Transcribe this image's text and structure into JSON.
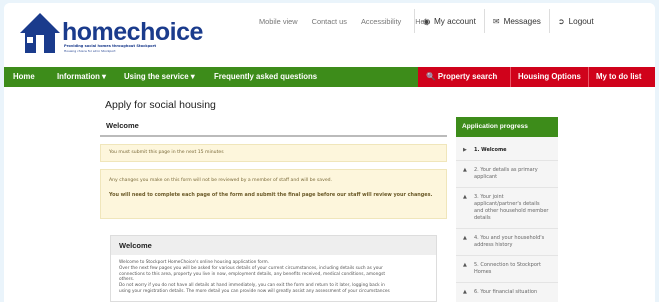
{
  "brand": {
    "name": "homechoice",
    "tagline1": "Providing social homes throughout Stockport",
    "tagline2": "Housing choice for all in Stockport"
  },
  "toplinks": [
    "Mobile view",
    "Contact us",
    "Accessibility",
    "Help"
  ],
  "account": {
    "my_account": "My account",
    "messages": "Messages",
    "logout": "Logout"
  },
  "nav": {
    "home": "Home",
    "information": "Information ▾",
    "using_service": "Using the service ▾",
    "faq": "Frequently asked questions",
    "property_search": "Property search",
    "housing_options": "Housing Options",
    "todo": "My to do list"
  },
  "page": {
    "title": "Apply for social housing",
    "tab": "Welcome",
    "timer_note": "You must submit this page in the next 15 minutes",
    "changes_note": "Any changes you make on this form will not be reviewed by a member of staff and will be saved.",
    "complete_note": "You will need to complete each page of the form and submit the final page before our staff will review your changes.",
    "card_title": "Welcome",
    "card_lines": [
      "Welcome to Stockport HomeChoice's online housing application form.",
      "Over the next few pages you will be asked for various details of your current circumstances, including details such as your",
      "connections to this area, property you live in now, employment details, any benefits received, medical conditions, amongst",
      "others.",
      "Do not worry if you do not have all details at hand immediately, you can exit the form and return to it later, logging back in",
      "using your registration details. The more detail you can provide now will greatly assist any assessment of your circumstances"
    ]
  },
  "progress": {
    "title": "Application progress",
    "steps": [
      "1. Welcome",
      "2. Your details as primary applicant",
      "3. Your joint applicant/partner's details and other household member details",
      "4. You and your household's address history",
      "5. Connection to Stockport Homes",
      "6. Your financial situation"
    ]
  },
  "colors": {
    "nav_green": "#3d8c1a",
    "accent_red": "#d0021b",
    "brand_blue": "#1a3b8c"
  }
}
